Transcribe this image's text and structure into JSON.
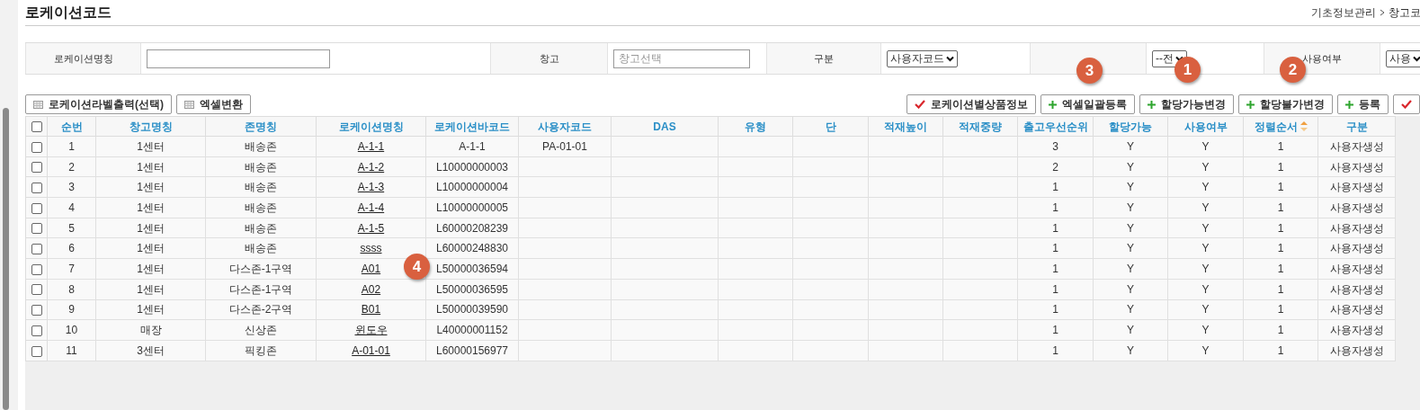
{
  "title": "로케이션코드",
  "breadcrumb": [
    "기초정보관리",
    "창고코"
  ],
  "filters": [
    {
      "label": "로케이션명칭",
      "kind": "text"
    },
    {
      "label": "창고",
      "kind": "text",
      "placeholder": "창고선택"
    },
    {
      "label": "구분",
      "kind": "select",
      "value": "사용자코드"
    },
    {
      "kind": "select",
      "value": "--전"
    },
    {
      "label": "사용여부",
      "kind": "select",
      "value": "사용"
    }
  ],
  "left_buttons": [
    {
      "label": "로케이션라벨출력(선택)",
      "kind": "print"
    },
    {
      "label": "엑셀변환",
      "kind": "print"
    }
  ],
  "right_buttons": [
    {
      "label": "로케이션별상품정보",
      "kind": "confirm"
    },
    {
      "label": "엑셀일괄등록",
      "kind": "add"
    },
    {
      "label": "할당가능변경",
      "kind": "add"
    },
    {
      "label": "할당불가변경",
      "kind": "add"
    },
    {
      "label": "등록",
      "kind": "add"
    },
    {
      "kind": "confirm"
    }
  ],
  "table": {
    "header_checked": false,
    "columns": [
      {
        "label": "순번",
        "kind": "text",
        "sorted": false
      },
      {
        "label": "창고명칭",
        "kind": "text",
        "sorted": false
      },
      {
        "label": "존명칭",
        "kind": "text",
        "sorted": false
      },
      {
        "label": "로케이션명칭",
        "kind": "link",
        "sorted": false
      },
      {
        "label": "로케이션바코드",
        "kind": "text",
        "sorted": false
      },
      {
        "label": "사용자코드",
        "kind": "text",
        "sorted": false
      },
      {
        "label": "DAS",
        "kind": "text",
        "sorted": false
      },
      {
        "label": "유형",
        "kind": "text",
        "sorted": false
      },
      {
        "label": "단",
        "kind": "text",
        "sorted": false
      },
      {
        "label": "적재높이",
        "kind": "text",
        "sorted": false
      },
      {
        "label": "적재중량",
        "kind": "text",
        "sorted": false
      },
      {
        "label": "출고우선순위",
        "kind": "text",
        "sorted": false
      },
      {
        "label": "할당가능",
        "kind": "text",
        "sorted": false
      },
      {
        "label": "사용여부",
        "kind": "text",
        "sorted": false
      },
      {
        "label": "정렬순서",
        "kind": "text",
        "sorted": true
      },
      {
        "label": "구분",
        "kind": "text",
        "sorted": false
      }
    ],
    "rows": [
      {
        "checked": false,
        "cells": [
          "1",
          "1센터",
          "배송존",
          "A-1-1",
          "A-1-1",
          "PA-01-01",
          "",
          "",
          "",
          "",
          "",
          "3",
          "Y",
          "Y",
          "1",
          "사용자생성"
        ]
      },
      {
        "checked": false,
        "cells": [
          "2",
          "1센터",
          "배송존",
          "A-1-2",
          "L10000000003",
          "",
          "",
          "",
          "",
          "",
          "",
          "2",
          "Y",
          "Y",
          "1",
          "사용자생성"
        ]
      },
      {
        "checked": false,
        "cells": [
          "3",
          "1센터",
          "배송존",
          "A-1-3",
          "L10000000004",
          "",
          "",
          "",
          "",
          "",
          "",
          "1",
          "Y",
          "Y",
          "1",
          "사용자생성"
        ]
      },
      {
        "checked": false,
        "cells": [
          "4",
          "1센터",
          "배송존",
          "A-1-4",
          "L10000000005",
          "",
          "",
          "",
          "",
          "",
          "",
          "1",
          "Y",
          "Y",
          "1",
          "사용자생성"
        ]
      },
      {
        "checked": false,
        "cells": [
          "5",
          "1센터",
          "배송존",
          "A-1-5",
          "L60000208239",
          "",
          "",
          "",
          "",
          "",
          "",
          "1",
          "Y",
          "Y",
          "1",
          "사용자생성"
        ]
      },
      {
        "checked": false,
        "cells": [
          "6",
          "1센터",
          "배송존",
          "ssss",
          "L60000248830",
          "",
          "",
          "",
          "",
          "",
          "",
          "1",
          "Y",
          "Y",
          "1",
          "사용자생성"
        ]
      },
      {
        "checked": false,
        "cells": [
          "7",
          "1센터",
          "다스존-1구역",
          "A01",
          "L50000036594",
          "",
          "",
          "",
          "",
          "",
          "",
          "1",
          "Y",
          "Y",
          "1",
          "사용자생성"
        ]
      },
      {
        "checked": false,
        "cells": [
          "8",
          "1센터",
          "다스존-1구역",
          "A02",
          "L50000036595",
          "",
          "",
          "",
          "",
          "",
          "",
          "1",
          "Y",
          "Y",
          "1",
          "사용자생성"
        ]
      },
      {
        "checked": false,
        "cells": [
          "9",
          "1센터",
          "다스존-2구역",
          "B01",
          "L50000039590",
          "",
          "",
          "",
          "",
          "",
          "",
          "1",
          "Y",
          "Y",
          "1",
          "사용자생성"
        ]
      },
      {
        "checked": false,
        "cells": [
          "10",
          "매장",
          "신상존",
          "윈도우",
          "L40000001152",
          "",
          "",
          "",
          "",
          "",
          "",
          "1",
          "Y",
          "Y",
          "1",
          "사용자생성"
        ]
      },
      {
        "checked": false,
        "cells": [
          "11",
          "3센터",
          "픽킹존",
          "A-01-01",
          "L60000156977",
          "",
          "",
          "",
          "",
          "",
          "",
          "1",
          "Y",
          "Y",
          "1",
          "사용자생성"
        ]
      }
    ]
  },
  "markers": [
    "3",
    "1",
    "2",
    "4"
  ]
}
